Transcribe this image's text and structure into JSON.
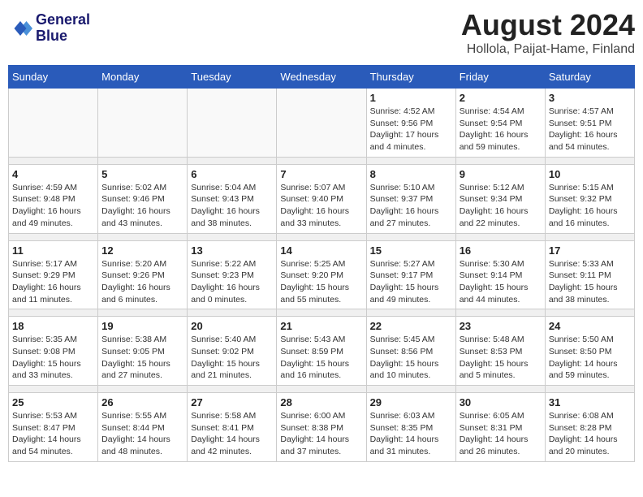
{
  "logo": {
    "line1": "General",
    "line2": "Blue"
  },
  "title": "August 2024",
  "subtitle": "Hollola, Paijat-Hame, Finland",
  "days": [
    "Sunday",
    "Monday",
    "Tuesday",
    "Wednesday",
    "Thursday",
    "Friday",
    "Saturday"
  ],
  "weeks": [
    [
      {
        "day": "",
        "info": ""
      },
      {
        "day": "",
        "info": ""
      },
      {
        "day": "",
        "info": ""
      },
      {
        "day": "",
        "info": ""
      },
      {
        "day": "1",
        "info": "Sunrise: 4:52 AM\nSunset: 9:56 PM\nDaylight: 17 hours\nand 4 minutes."
      },
      {
        "day": "2",
        "info": "Sunrise: 4:54 AM\nSunset: 9:54 PM\nDaylight: 16 hours\nand 59 minutes."
      },
      {
        "day": "3",
        "info": "Sunrise: 4:57 AM\nSunset: 9:51 PM\nDaylight: 16 hours\nand 54 minutes."
      }
    ],
    [
      {
        "day": "4",
        "info": "Sunrise: 4:59 AM\nSunset: 9:48 PM\nDaylight: 16 hours\nand 49 minutes."
      },
      {
        "day": "5",
        "info": "Sunrise: 5:02 AM\nSunset: 9:46 PM\nDaylight: 16 hours\nand 43 minutes."
      },
      {
        "day": "6",
        "info": "Sunrise: 5:04 AM\nSunset: 9:43 PM\nDaylight: 16 hours\nand 38 minutes."
      },
      {
        "day": "7",
        "info": "Sunrise: 5:07 AM\nSunset: 9:40 PM\nDaylight: 16 hours\nand 33 minutes."
      },
      {
        "day": "8",
        "info": "Sunrise: 5:10 AM\nSunset: 9:37 PM\nDaylight: 16 hours\nand 27 minutes."
      },
      {
        "day": "9",
        "info": "Sunrise: 5:12 AM\nSunset: 9:34 PM\nDaylight: 16 hours\nand 22 minutes."
      },
      {
        "day": "10",
        "info": "Sunrise: 5:15 AM\nSunset: 9:32 PM\nDaylight: 16 hours\nand 16 minutes."
      }
    ],
    [
      {
        "day": "11",
        "info": "Sunrise: 5:17 AM\nSunset: 9:29 PM\nDaylight: 16 hours\nand 11 minutes."
      },
      {
        "day": "12",
        "info": "Sunrise: 5:20 AM\nSunset: 9:26 PM\nDaylight: 16 hours\nand 6 minutes."
      },
      {
        "day": "13",
        "info": "Sunrise: 5:22 AM\nSunset: 9:23 PM\nDaylight: 16 hours\nand 0 minutes."
      },
      {
        "day": "14",
        "info": "Sunrise: 5:25 AM\nSunset: 9:20 PM\nDaylight: 15 hours\nand 55 minutes."
      },
      {
        "day": "15",
        "info": "Sunrise: 5:27 AM\nSunset: 9:17 PM\nDaylight: 15 hours\nand 49 minutes."
      },
      {
        "day": "16",
        "info": "Sunrise: 5:30 AM\nSunset: 9:14 PM\nDaylight: 15 hours\nand 44 minutes."
      },
      {
        "day": "17",
        "info": "Sunrise: 5:33 AM\nSunset: 9:11 PM\nDaylight: 15 hours\nand 38 minutes."
      }
    ],
    [
      {
        "day": "18",
        "info": "Sunrise: 5:35 AM\nSunset: 9:08 PM\nDaylight: 15 hours\nand 33 minutes."
      },
      {
        "day": "19",
        "info": "Sunrise: 5:38 AM\nSunset: 9:05 PM\nDaylight: 15 hours\nand 27 minutes."
      },
      {
        "day": "20",
        "info": "Sunrise: 5:40 AM\nSunset: 9:02 PM\nDaylight: 15 hours\nand 21 minutes."
      },
      {
        "day": "21",
        "info": "Sunrise: 5:43 AM\nSunset: 8:59 PM\nDaylight: 15 hours\nand 16 minutes."
      },
      {
        "day": "22",
        "info": "Sunrise: 5:45 AM\nSunset: 8:56 PM\nDaylight: 15 hours\nand 10 minutes."
      },
      {
        "day": "23",
        "info": "Sunrise: 5:48 AM\nSunset: 8:53 PM\nDaylight: 15 hours\nand 5 minutes."
      },
      {
        "day": "24",
        "info": "Sunrise: 5:50 AM\nSunset: 8:50 PM\nDaylight: 14 hours\nand 59 minutes."
      }
    ],
    [
      {
        "day": "25",
        "info": "Sunrise: 5:53 AM\nSunset: 8:47 PM\nDaylight: 14 hours\nand 54 minutes."
      },
      {
        "day": "26",
        "info": "Sunrise: 5:55 AM\nSunset: 8:44 PM\nDaylight: 14 hours\nand 48 minutes."
      },
      {
        "day": "27",
        "info": "Sunrise: 5:58 AM\nSunset: 8:41 PM\nDaylight: 14 hours\nand 42 minutes."
      },
      {
        "day": "28",
        "info": "Sunrise: 6:00 AM\nSunset: 8:38 PM\nDaylight: 14 hours\nand 37 minutes."
      },
      {
        "day": "29",
        "info": "Sunrise: 6:03 AM\nSunset: 8:35 PM\nDaylight: 14 hours\nand 31 minutes."
      },
      {
        "day": "30",
        "info": "Sunrise: 6:05 AM\nSunset: 8:31 PM\nDaylight: 14 hours\nand 26 minutes."
      },
      {
        "day": "31",
        "info": "Sunrise: 6:08 AM\nSunset: 8:28 PM\nDaylight: 14 hours\nand 20 minutes."
      }
    ]
  ]
}
